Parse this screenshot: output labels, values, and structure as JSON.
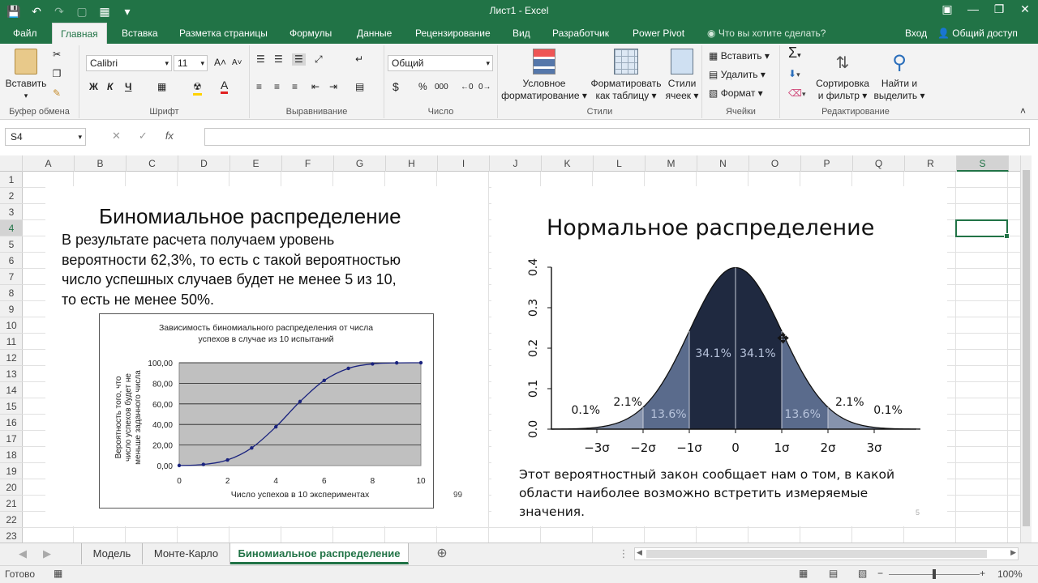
{
  "window": {
    "title": "Лист1 - Excel"
  },
  "ribbon_tabs": [
    {
      "label": "Файл",
      "active": false
    },
    {
      "label": "Главная",
      "active": true
    },
    {
      "label": "Вставка",
      "active": false
    },
    {
      "label": "Разметка страницы",
      "active": false
    },
    {
      "label": "Формулы",
      "active": false
    },
    {
      "label": "Данные",
      "active": false
    },
    {
      "label": "Рецензирование",
      "active": false
    },
    {
      "label": "Вид",
      "active": false
    },
    {
      "label": "Разработчик",
      "active": false
    },
    {
      "label": "Power Pivot",
      "active": false
    }
  ],
  "tellme": "Что вы хотите сделать?",
  "signin": "Вход",
  "share": "Общий доступ",
  "ribbon": {
    "clipboard": {
      "paste": "Вставить",
      "label": "Буфер обмена"
    },
    "font": {
      "name": "Calibri",
      "size": "11",
      "label": "Шрифт",
      "bold": "Ж",
      "italic": "К",
      "underline": "Ч"
    },
    "alignment": {
      "label": "Выравнивание"
    },
    "number": {
      "format": "Общий",
      "label": "Число",
      "currency": "$",
      "percent": "%",
      "thousands": "000"
    },
    "styles": {
      "cond_format_1": "Условное",
      "cond_format_2": "форматирование",
      "format_table_1": "Форматировать",
      "format_table_2": "как таблицу",
      "cell_styles_1": "Стили",
      "cell_styles_2": "ячеек",
      "label": "Стили"
    },
    "cells": {
      "insert": "Вставить",
      "delete": "Удалить",
      "format": "Формат",
      "label": "Ячейки"
    },
    "editing": {
      "sort_1": "Сортировка",
      "sort_2": "и фильтр",
      "find_1": "Найти и",
      "find_2": "выделить",
      "label": "Редактирование"
    }
  },
  "formula_bar": {
    "name_box": "S4",
    "fx": "fx",
    "value": ""
  },
  "columns": [
    "A",
    "B",
    "C",
    "D",
    "E",
    "F",
    "G",
    "H",
    "I",
    "J",
    "K",
    "L",
    "M",
    "N",
    "O",
    "P",
    "Q",
    "R",
    "S"
  ],
  "rows": [
    "1",
    "2",
    "3",
    "4",
    "5",
    "6",
    "7",
    "8",
    "9",
    "10",
    "11",
    "12",
    "13",
    "14",
    "15",
    "16",
    "17",
    "18",
    "19",
    "20",
    "21",
    "22",
    "23"
  ],
  "selected_cell": "S4",
  "left_slide": {
    "title": "Биномиальное распределение",
    "lines": [
      "В результате расчета получаем уровень",
      "вероятности 62,3%, то есть с такой вероятностью",
      "число успешных случаев будет не менее 5 из 10,",
      "то есть не менее 50%."
    ],
    "page_number": "99"
  },
  "right_slide": {
    "title": "Нормальное распределение",
    "lines": [
      "Этот вероятностный закон сообщает нам о том, в какой",
      "области наиболее возможно встретить измеряемые",
      "значения."
    ],
    "page_number": "5"
  },
  "chart_data": [
    {
      "type": "line",
      "title": "Зависимость биномиального распределения от числа успехов в случае из 10 испытаний",
      "title_lines": [
        "Зависимость биномиального распределения от числа",
        "успехов в случае из 10 испытаний"
      ],
      "xlabel": "Число успехов в 10 экспериментах",
      "ylabel_lines": [
        "Вероятность того, что",
        "число успехов будет не",
        "меньше заданного числа"
      ],
      "x": [
        0,
        1,
        2,
        3,
        4,
        5,
        6,
        7,
        8,
        9,
        10
      ],
      "y": [
        0.1,
        1.1,
        5.5,
        17.2,
        37.7,
        62.3,
        82.8,
        94.5,
        98.9,
        99.9,
        100
      ],
      "xlim": [
        0,
        10
      ],
      "ylim": [
        0,
        100
      ],
      "xticks": [
        "0",
        "2",
        "4",
        "6",
        "8",
        "10"
      ],
      "yticks": [
        "0,00",
        "20,00",
        "40,00",
        "60,00",
        "80,00",
        "100,00"
      ],
      "grid": true
    },
    {
      "type": "area",
      "title": "",
      "x_ticks": [
        "−3σ",
        "−2σ",
        "−1σ",
        "0",
        "1σ",
        "2σ",
        "3σ"
      ],
      "y_ticks": [
        "0.0",
        "0.1",
        "0.2",
        "0.3",
        "0.4"
      ],
      "xlim": [
        -4,
        4
      ],
      "ylim": [
        0,
        0.4
      ],
      "bands": [
        {
          "range": "-1σ..0",
          "label": "34.1%"
        },
        {
          "range": "0..1σ",
          "label": "34.1%"
        },
        {
          "range": "-2σ..-1σ",
          "label": "13.6%"
        },
        {
          "range": "1σ..2σ",
          "label": "13.6%"
        },
        {
          "range": "-3σ..-2σ",
          "label": "2.1%"
        },
        {
          "range": "2σ..3σ",
          "label": "2.1%"
        },
        {
          "range": "<-3σ",
          "label": "0.1%"
        },
        {
          "range": ">3σ",
          "label": "0.1%"
        }
      ],
      "colors": {
        "band1": "#1f2940",
        "band2": "#5a6b8c",
        "band3": "#8693ad"
      }
    }
  ],
  "sheet_tabs": [
    {
      "label": "Модель",
      "active": false
    },
    {
      "label": "Монте-Карло",
      "active": false
    },
    {
      "label": "Биномиальное распределение",
      "active": true
    }
  ],
  "status": {
    "ready": "Готово",
    "zoom": "100%"
  },
  "colors": {
    "accent": "#217346"
  }
}
